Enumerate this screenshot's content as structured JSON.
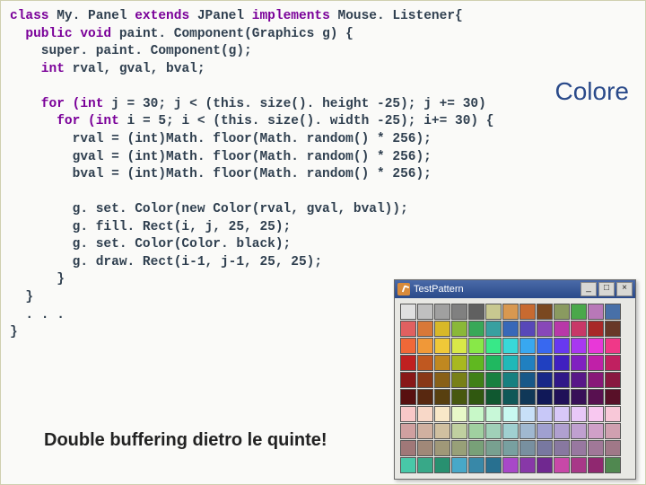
{
  "title_right": "Colore",
  "caption": "Double buffering dietro le quinte!",
  "window": {
    "title": "TestPattern",
    "btn_min": "_",
    "btn_max": "□",
    "btn_close": "×"
  },
  "code": {
    "l1a": "class",
    "l1b": " My. Panel ",
    "l1c": "extends",
    "l1d": " JPanel ",
    "l1e": "implements",
    "l1f": " Mouse. Listener{",
    "l2a": "  public",
    "l2b": " void",
    "l2c": " paint. Component(Graphics g) {",
    "l3": "    super. paint. Component(g);",
    "l4a": "    int",
    "l4b": " rval, gval, bval;",
    "blank1": "",
    "l5a": "    for",
    "l5b": " (int",
    "l5c": " j = 30; j < (this. size(). height -25); j += 30)",
    "l6a": "      for",
    "l6b": " (int",
    "l6c": " i = 5; i < (this. size(). width -25); i+= 30) {",
    "l7": "        rval = (int)Math. floor(Math. random() * 256);",
    "l8": "        gval = (int)Math. floor(Math. random() * 256);",
    "l9": "        bval = (int)Math. floor(Math. random() * 256);",
    "blank2": "",
    "l10": "        g. set. Color(new Color(rval, gval, bval));",
    "l11": "        g. fill. Rect(i, j, 25, 25);",
    "l12": "        g. set. Color(Color. black);",
    "l13": "        g. draw. Rect(i-1, j-1, 25, 25);",
    "l14": "      }",
    "l15": "  }",
    "l16": "  . . .",
    "l17": "}"
  },
  "swatches": [
    "#e0e0e0",
    "#c0c0c0",
    "#a0a0a0",
    "#808080",
    "#606060",
    "#c8c890",
    "#d89850",
    "#c86a30",
    "#7a4820",
    "#8a9a60",
    "#4aa84a",
    "#b878b8",
    "#4870a8",
    "#e06060",
    "#d87838",
    "#d8b828",
    "#8ab838",
    "#38a858",
    "#38a0a0",
    "#3868b8",
    "#5848b8",
    "#8848b8",
    "#b838a8",
    "#c83868",
    "#a82828",
    "#683828",
    "#f06838",
    "#f09838",
    "#f0c838",
    "#d8e848",
    "#88e848",
    "#38e888",
    "#38d8d8",
    "#38a8f0",
    "#3868f0",
    "#6838f0",
    "#a838f0",
    "#e838d8",
    "#f03888",
    "#c02020",
    "#c05820",
    "#c08820",
    "#a8b820",
    "#60b820",
    "#20b860",
    "#20b8b8",
    "#2080c0",
    "#2040c0",
    "#4020c0",
    "#8020c0",
    "#c020a8",
    "#c02060",
    "#881818",
    "#883818",
    "#886018",
    "#788018",
    "#408018",
    "#188040",
    "#188080",
    "#185888",
    "#182888",
    "#301888",
    "#581888",
    "#881878",
    "#881840",
    "#581010",
    "#582810",
    "#584010",
    "#485810",
    "#305810",
    "#105830",
    "#105858",
    "#103858",
    "#101858",
    "#201058",
    "#381058",
    "#581050",
    "#581028",
    "#f8c8c8",
    "#f8d8c8",
    "#f8e8c8",
    "#e8f8c8",
    "#c8f8c8",
    "#c8f8d8",
    "#c8f8f0",
    "#c8e0f8",
    "#c8c8f8",
    "#d8c8f8",
    "#e8c8f8",
    "#f8c8f0",
    "#f8c8d8",
    "#d0a0a0",
    "#d0b0a0",
    "#d0c0a0",
    "#c0d0a0",
    "#a0d0a0",
    "#a0d0b8",
    "#a0d0d0",
    "#a0b8d0",
    "#a0a0d0",
    "#b0a0d0",
    "#c0a0d0",
    "#d0a0c8",
    "#d0a0b0",
    "#a07878",
    "#a08878",
    "#a09878",
    "#98a078",
    "#78a078",
    "#78a090",
    "#78a0a0",
    "#7890a0",
    "#7878a0",
    "#8878a0",
    "#9878a0",
    "#a07898",
    "#a07888",
    "#48c8a8",
    "#38a888",
    "#289070",
    "#48a8c8",
    "#3888a8",
    "#287090",
    "#a848c8",
    "#8838a8",
    "#702890",
    "#c848a8",
    "#a83888",
    "#902870",
    "#508850"
  ]
}
